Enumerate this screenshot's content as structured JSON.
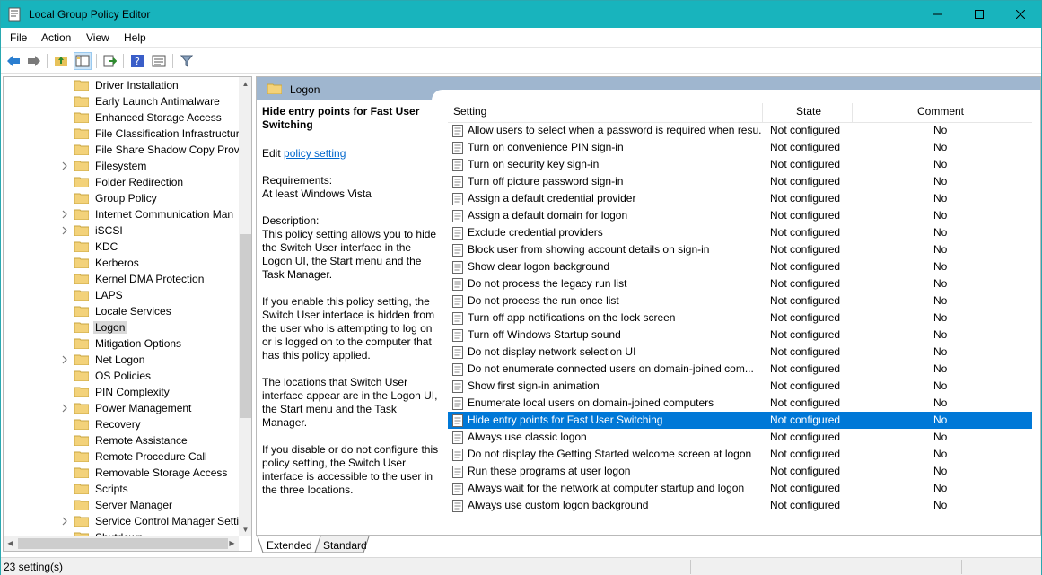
{
  "window": {
    "title": "Local Group Policy Editor",
    "colors": {
      "titlebar": "#18b4bd",
      "selection": "#0078d7",
      "pane_header": "#9fb6cf",
      "link": "#0066cc"
    }
  },
  "menu": {
    "file": "File",
    "action": "Action",
    "view": "View",
    "help": "Help"
  },
  "toolbar": {
    "icons": [
      "back-arrow-icon",
      "forward-arrow-icon",
      "up-folder-icon",
      "show-hide-tree-icon",
      "export-list-icon",
      "help-icon",
      "properties-icon",
      "filter-icon"
    ]
  },
  "tree": {
    "items": [
      {
        "label": "Driver Installation",
        "expandable": false
      },
      {
        "label": "Early Launch Antimalware",
        "expandable": false
      },
      {
        "label": "Enhanced Storage Access",
        "expandable": false
      },
      {
        "label": "File Classification Infrastructur",
        "expandable": false
      },
      {
        "label": "File Share Shadow Copy Provic",
        "expandable": false
      },
      {
        "label": "Filesystem",
        "expandable": true
      },
      {
        "label": "Folder Redirection",
        "expandable": false
      },
      {
        "label": "Group Policy",
        "expandable": false
      },
      {
        "label": "Internet Communication Man",
        "expandable": true
      },
      {
        "label": "iSCSI",
        "expandable": true
      },
      {
        "label": "KDC",
        "expandable": false
      },
      {
        "label": "Kerberos",
        "expandable": false
      },
      {
        "label": "Kernel DMA Protection",
        "expandable": false
      },
      {
        "label": "LAPS",
        "expandable": false
      },
      {
        "label": "Locale Services",
        "expandable": false
      },
      {
        "label": "Logon",
        "expandable": false,
        "selected": true
      },
      {
        "label": "Mitigation Options",
        "expandable": false
      },
      {
        "label": "Net Logon",
        "expandable": true
      },
      {
        "label": "OS Policies",
        "expandable": false
      },
      {
        "label": "PIN Complexity",
        "expandable": false
      },
      {
        "label": "Power Management",
        "expandable": true
      },
      {
        "label": "Recovery",
        "expandable": false
      },
      {
        "label": "Remote Assistance",
        "expandable": false
      },
      {
        "label": "Remote Procedure Call",
        "expandable": false
      },
      {
        "label": "Removable Storage Access",
        "expandable": false
      },
      {
        "label": "Scripts",
        "expandable": false
      },
      {
        "label": "Server Manager",
        "expandable": false
      },
      {
        "label": "Service Control Manager Settir",
        "expandable": true
      },
      {
        "label": "Shutdown",
        "expandable": false
      }
    ]
  },
  "pane": {
    "header_title": "Logon",
    "desc_title": "Hide entry points for Fast User Switching",
    "edit_prefix": "Edit ",
    "edit_link": "policy setting ",
    "requirements_label": "Requirements:",
    "requirements_value": "At least Windows Vista",
    "description_label": "Description:",
    "description_p1": "This policy setting allows you to hide the Switch User interface in the Logon UI, the Start menu and the Task Manager.",
    "description_p2": "If you enable this policy setting, the Switch User interface is hidden from the user who is attempting to log on or is logged on to the computer that has this policy applied.",
    "description_p3": "The locations that Switch User interface appear are in the Logon UI, the Start menu and the Task Manager.",
    "description_p4": "If you disable or do not configure this policy setting, the Switch User interface is accessible to the user in the three locations."
  },
  "list": {
    "columns": {
      "setting": "Setting",
      "state": "State",
      "comment": "Comment"
    },
    "rows": [
      {
        "setting": "Allow users to select when a password is required when resu...",
        "state": "Not configured",
        "comment": "No"
      },
      {
        "setting": "Turn on convenience PIN sign-in",
        "state": "Not configured",
        "comment": "No"
      },
      {
        "setting": "Turn on security key sign-in",
        "state": "Not configured",
        "comment": "No"
      },
      {
        "setting": "Turn off picture password sign-in",
        "state": "Not configured",
        "comment": "No"
      },
      {
        "setting": "Assign a default credential provider",
        "state": "Not configured",
        "comment": "No"
      },
      {
        "setting": "Assign a default domain for logon",
        "state": "Not configured",
        "comment": "No"
      },
      {
        "setting": "Exclude credential providers",
        "state": "Not configured",
        "comment": "No"
      },
      {
        "setting": "Block user from showing account details on sign-in",
        "state": "Not configured",
        "comment": "No"
      },
      {
        "setting": "Show clear logon background",
        "state": "Not configured",
        "comment": "No"
      },
      {
        "setting": "Do not process the legacy run list",
        "state": "Not configured",
        "comment": "No"
      },
      {
        "setting": "Do not process the run once list",
        "state": "Not configured",
        "comment": "No"
      },
      {
        "setting": "Turn off app notifications on the lock screen",
        "state": "Not configured",
        "comment": "No"
      },
      {
        "setting": "Turn off Windows Startup sound",
        "state": "Not configured",
        "comment": "No"
      },
      {
        "setting": "Do not display network selection UI",
        "state": "Not configured",
        "comment": "No"
      },
      {
        "setting": "Do not enumerate connected users on domain-joined com...",
        "state": "Not configured",
        "comment": "No"
      },
      {
        "setting": "Show first sign-in animation",
        "state": "Not configured",
        "comment": "No"
      },
      {
        "setting": "Enumerate local users on domain-joined computers",
        "state": "Not configured",
        "comment": "No"
      },
      {
        "setting": "Hide entry points for Fast User Switching",
        "state": "Not configured",
        "comment": "No",
        "selected": true
      },
      {
        "setting": "Always use classic logon",
        "state": "Not configured",
        "comment": "No"
      },
      {
        "setting": "Do not display the Getting Started welcome screen at logon",
        "state": "Not configured",
        "comment": "No"
      },
      {
        "setting": "Run these programs at user logon",
        "state": "Not configured",
        "comment": "No"
      },
      {
        "setting": "Always wait for the network at computer startup and logon",
        "state": "Not configured",
        "comment": "No"
      },
      {
        "setting": "Always use custom logon background",
        "state": "Not configured",
        "comment": "No"
      }
    ]
  },
  "tabs": {
    "extended": "Extended",
    "standard": "Standard"
  },
  "status": {
    "text": "23 setting(s)"
  }
}
